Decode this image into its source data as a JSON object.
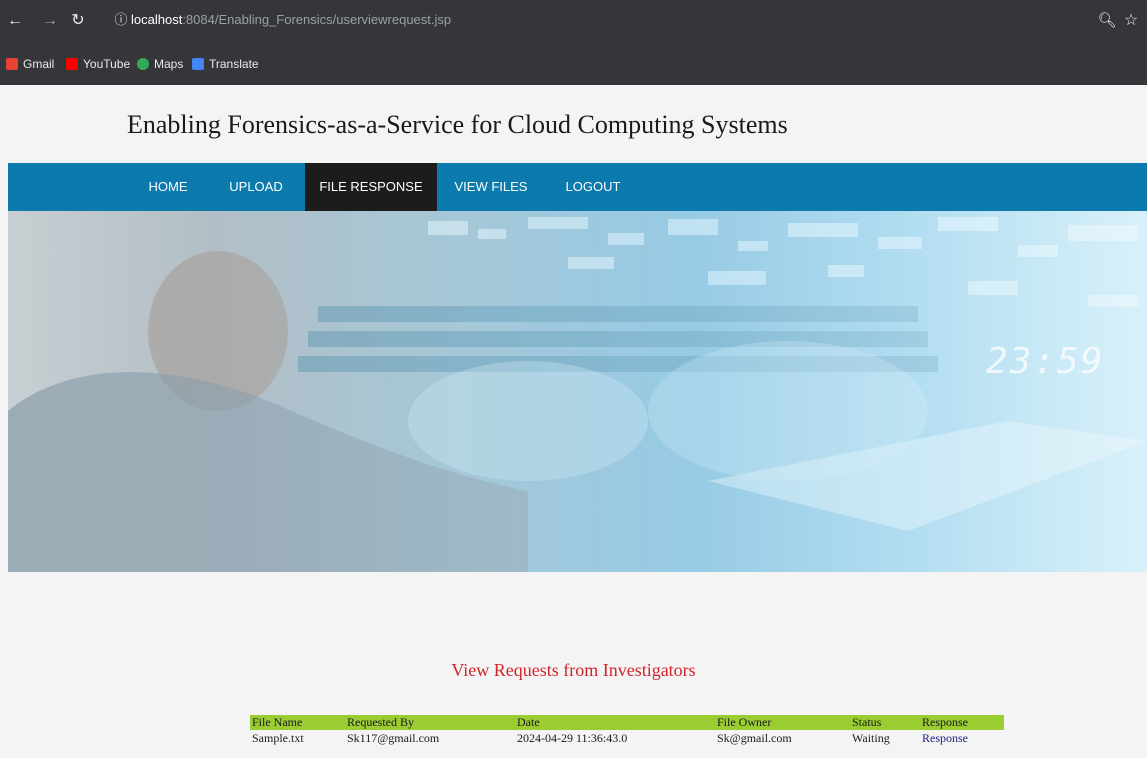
{
  "browser": {
    "back_icon": "arrow-left-icon",
    "forward_icon": "arrow-right-icon",
    "reload_icon": "reload-icon",
    "info_icon": "info-icon",
    "url_host": "localhost",
    "url_rest": ":8084/Enabling_Forensics/userviewrequest.jsp",
    "zoom_icon": "zoom-icon",
    "star_icon": "star-icon",
    "bookmarks": [
      {
        "label": "Gmail",
        "icon": "gmail-icon",
        "color": "#ea4335"
      },
      {
        "label": "YouTube",
        "icon": "youtube-icon",
        "color": "#ff0000"
      },
      {
        "label": "Maps",
        "icon": "maps-icon",
        "color": "#34a853"
      },
      {
        "label": "Translate",
        "icon": "translate-icon",
        "color": "#4285f4"
      }
    ]
  },
  "site": {
    "title": "Enabling Forensics-as-a-Service for Cloud Computing Systems"
  },
  "nav": {
    "items": [
      {
        "label": "HOME",
        "active": false
      },
      {
        "label": "UPLOAD",
        "active": false
      },
      {
        "label": "FILE RESPONSE",
        "active": true
      },
      {
        "label": "VIEW FILES",
        "active": false
      },
      {
        "label": "LOGOUT",
        "active": false
      }
    ]
  },
  "banner": {
    "clock_text": "23:59"
  },
  "content": {
    "section_title": "View Requests from Investigators",
    "table": {
      "headers": [
        "File Name",
        "Requested By",
        "Date",
        "File Owner",
        "Status",
        "Response"
      ],
      "rows": [
        [
          "Sample.txt",
          "Sk117@gmail.com",
          "2024-04-29 11:36:43.0",
          "Sk@gmail.com",
          "Waiting",
          "Response"
        ]
      ]
    }
  },
  "colors": {
    "nav_bg": "#0c7aad",
    "nav_active": "#1c1c1c",
    "table_header": "#9acd32",
    "section_title": "#d0242a"
  }
}
